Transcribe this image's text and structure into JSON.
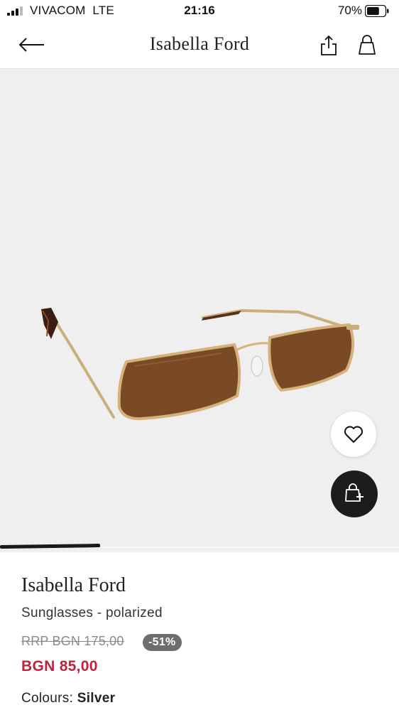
{
  "status_bar": {
    "carrier": "VIVACOM",
    "network": "LTE",
    "time": "21:16",
    "battery_percent": "70%",
    "battery_level": 0.7
  },
  "nav": {
    "title": "Isabella Ford",
    "icons": [
      "arrow-left-icon",
      "share-icon",
      "shopping-bag-icon"
    ]
  },
  "gallery": {
    "progress_fraction": 0.25,
    "wishlist_icon": "heart-icon",
    "add_to_bag_icon": "bag-plus-icon"
  },
  "product": {
    "brand": "Isabella Ford",
    "description": "Sunglasses - polarized",
    "rrp": "RRP BGN 175,00",
    "discount": "-51%",
    "price": "BGN 85,00",
    "colours_label": "Colours:",
    "colours_value": "Silver"
  },
  "colors": {
    "sale_price": "#c0223b",
    "badge": "#6e6e6e",
    "image_bg": "#efefef"
  }
}
